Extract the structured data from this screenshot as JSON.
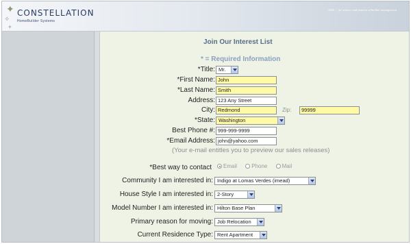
{
  "header": {
    "logo_text": "CONSTELLATION",
    "logo_subtext": "HomeBuilder Systems",
    "tagline": "2005 ... for science and passion of builder management"
  },
  "form": {
    "title": "Join Our Interest List",
    "required_note": "* = Required Information",
    "title_label": "*Title:",
    "title_value": "Mr.",
    "first_name_label": "*First Name:",
    "first_name_value": "John",
    "last_name_label": "*Last Name:",
    "last_name_value": "Smith",
    "address_label": "Address:",
    "address_value": "123 Any Street",
    "city_label": "City:",
    "city_value": "Redmond",
    "zip_label": "Zip:",
    "zip_value": "99999",
    "state_label": "*State:",
    "state_value": "Washington",
    "phone_label": "Best Phone #:",
    "phone_value": "999-999-9999",
    "email_label": "*Email Address:",
    "email_value": "john@yahoo.com",
    "email_note": "(Your e-mail entitles you to preview our sales releases)",
    "contact_label": "*Best way to contact",
    "contact_options": [
      "Email",
      "Phone",
      "Mail"
    ],
    "community_label": "Community I am interested in:",
    "community_value": "Indigo at Lomas Verdes (imead)",
    "house_style_label": "House Style I am interested in:",
    "house_style_value": "2-Story",
    "model_label": "Model Number I am interested in:",
    "model_value": "Hilton Base Plan",
    "reason_label": "Primary reason for moving:",
    "reason_value": "Job Relocation",
    "residence_label": "Current Residence Type:",
    "residence_value": "Rent Apartment"
  },
  "colors": {
    "required_field": "#fffaa6",
    "content_bg": "#eef3e6",
    "sidebar_bg": "#cfd4d9",
    "logo_text": "#283a64"
  }
}
